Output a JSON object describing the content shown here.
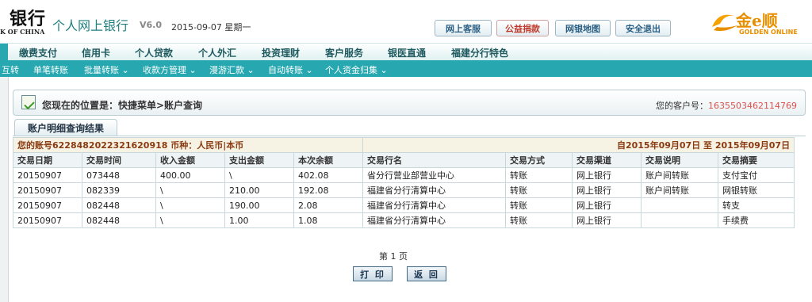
{
  "header": {
    "bank_name": "银行",
    "bank_sub": "K OF CHINA",
    "app_title": "个人网上银行",
    "version": "V6.0",
    "date": "2015-09-07 星期一",
    "buttons": [
      "网上客服",
      "公益捐款",
      "网银地图",
      "安全退出"
    ],
    "logo_text": "金e顺",
    "logo_en": "GOLDEN ONLINE",
    "accent_color": "#c0392b",
    "brand_color": "#27a8b0"
  },
  "main_nav": [
    "缴费支付",
    "信用卡",
    "个人贷款",
    "个人外汇",
    "投资理财",
    "客户服务",
    "银医直通",
    "福建分行特色"
  ],
  "sub_nav": [
    "互转",
    "单笔转账",
    "批量转账 ⌄",
    "收款方管理 ⌄",
    "漫游汇款 ⌄",
    "自动转账 ⌄",
    "个人资金归集 ⌄"
  ],
  "breadcrumb": {
    "location": "您现在的位置是：快捷菜单>账户查询",
    "customer_label": "您的客户号：",
    "customer_no": "1635503462114769"
  },
  "section_title": "账户明细查询结果",
  "summary": {
    "account_label": "您的账号6228482022321620918 币种：人民币|本币",
    "range": "自2015年09月07日  至  2015年09月07日"
  },
  "table": {
    "columns": [
      "交易日期",
      "交易时间",
      "收入金额",
      "支出金额",
      "本次余额",
      "交易行名",
      "交易方式",
      "交易渠道",
      "交易说明",
      "交易摘要"
    ],
    "rows": [
      [
        "20150907",
        "073448",
        "400.00",
        "\\",
        "402.08",
        "省分行营业部营业中心",
        "转账",
        "网上银行",
        "账户间转账",
        "支付宝付"
      ],
      [
        "20150907",
        "082339",
        "\\",
        "210.00",
        "192.08",
        "福建省分行清算中心",
        "转账",
        "网上银行",
        "账户间转账",
        "网银转账"
      ],
      [
        "20150907",
        "082448",
        "\\",
        "190.00",
        "2.08",
        "福建省分行清算中心",
        "转账",
        "网上银行",
        "",
        "转支"
      ],
      [
        "20150907",
        "082448",
        "\\",
        "1.00",
        "1.08",
        "福建省分行清算中心",
        "转账",
        "网上银行",
        "",
        "手续费"
      ]
    ]
  },
  "pager": "第 1 页",
  "actions": {
    "print": "打 印",
    "back": "返 回"
  }
}
